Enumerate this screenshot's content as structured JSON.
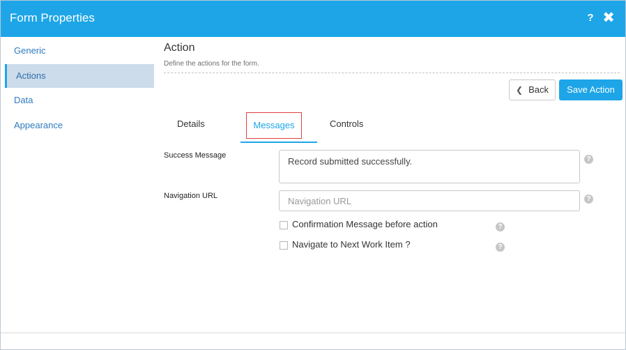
{
  "window": {
    "title": "Form Properties",
    "help_label": "?",
    "close_label": "✖"
  },
  "sidebar": {
    "items": [
      {
        "label": "Generic"
      },
      {
        "label": "Actions"
      },
      {
        "label": "Data"
      },
      {
        "label": "Appearance"
      }
    ]
  },
  "section": {
    "title": "Action",
    "subtitle": "Define the actions for the form."
  },
  "buttons": {
    "back_label": "Back",
    "save_label": "Save Action"
  },
  "tabs": [
    {
      "label": "Details"
    },
    {
      "label": "Messages"
    },
    {
      "label": "Controls"
    }
  ],
  "fields": {
    "success_message": {
      "label": "Success Message",
      "value": "Record submitted successfully."
    },
    "navigation_url": {
      "label": "Navigation URL",
      "placeholder": "Navigation URL"
    }
  },
  "checkboxes": [
    {
      "label": "Confirmation Message before action",
      "checked": false
    },
    {
      "label": "Navigate to Next Work Item ?",
      "checked": false
    }
  ],
  "help_icon_glyph": "?",
  "colors": {
    "accent": "#1da5e8",
    "active_nav_bg": "#cddcea",
    "tab_highlight_border": "#e0403f"
  }
}
